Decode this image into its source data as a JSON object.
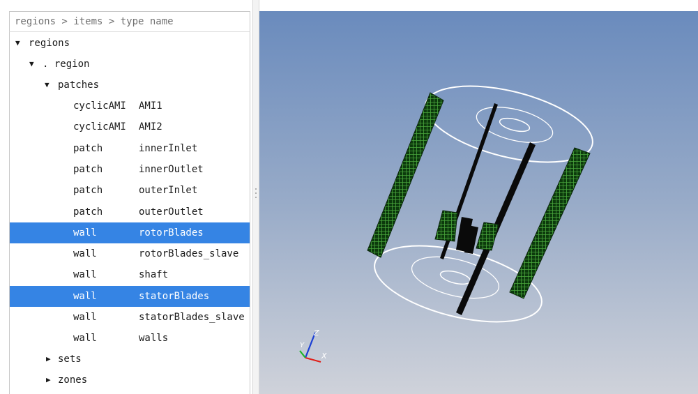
{
  "tree": {
    "header": "regions > items > type name",
    "nodes": {
      "regions": "regions",
      "region": ". region",
      "patches": "patches",
      "sets": "sets",
      "zones": "zones"
    },
    "patches": [
      {
        "type": "cyclicAMI",
        "name": "AMI1",
        "selected": false
      },
      {
        "type": "cyclicAMI",
        "name": "AMI2",
        "selected": false
      },
      {
        "type": "patch",
        "name": "innerInlet",
        "selected": false
      },
      {
        "type": "patch",
        "name": "innerOutlet",
        "selected": false
      },
      {
        "type": "patch",
        "name": "outerInlet",
        "selected": false
      },
      {
        "type": "patch",
        "name": "outerOutlet",
        "selected": false
      },
      {
        "type": "wall",
        "name": "rotorBlades",
        "selected": true
      },
      {
        "type": "wall",
        "name": "rotorBlades_slave",
        "selected": false
      },
      {
        "type": "wall",
        "name": "shaft",
        "selected": false
      },
      {
        "type": "wall",
        "name": "statorBlades",
        "selected": true
      },
      {
        "type": "wall",
        "name": "statorBlades_slave",
        "selected": false
      },
      {
        "type": "wall",
        "name": "walls",
        "selected": false
      }
    ]
  },
  "viewport": {
    "axes": {
      "z": "Z",
      "y": "Y",
      "x": "X"
    },
    "colors": {
      "wireframe": "#ffffff",
      "mesh": "#0c3a0c",
      "solid": "#0a0a0a",
      "axis_x": "#e0201a",
      "axis_y": "#1fb52a",
      "axis_z": "#1b3fd4",
      "selection": "#3584e4"
    }
  }
}
